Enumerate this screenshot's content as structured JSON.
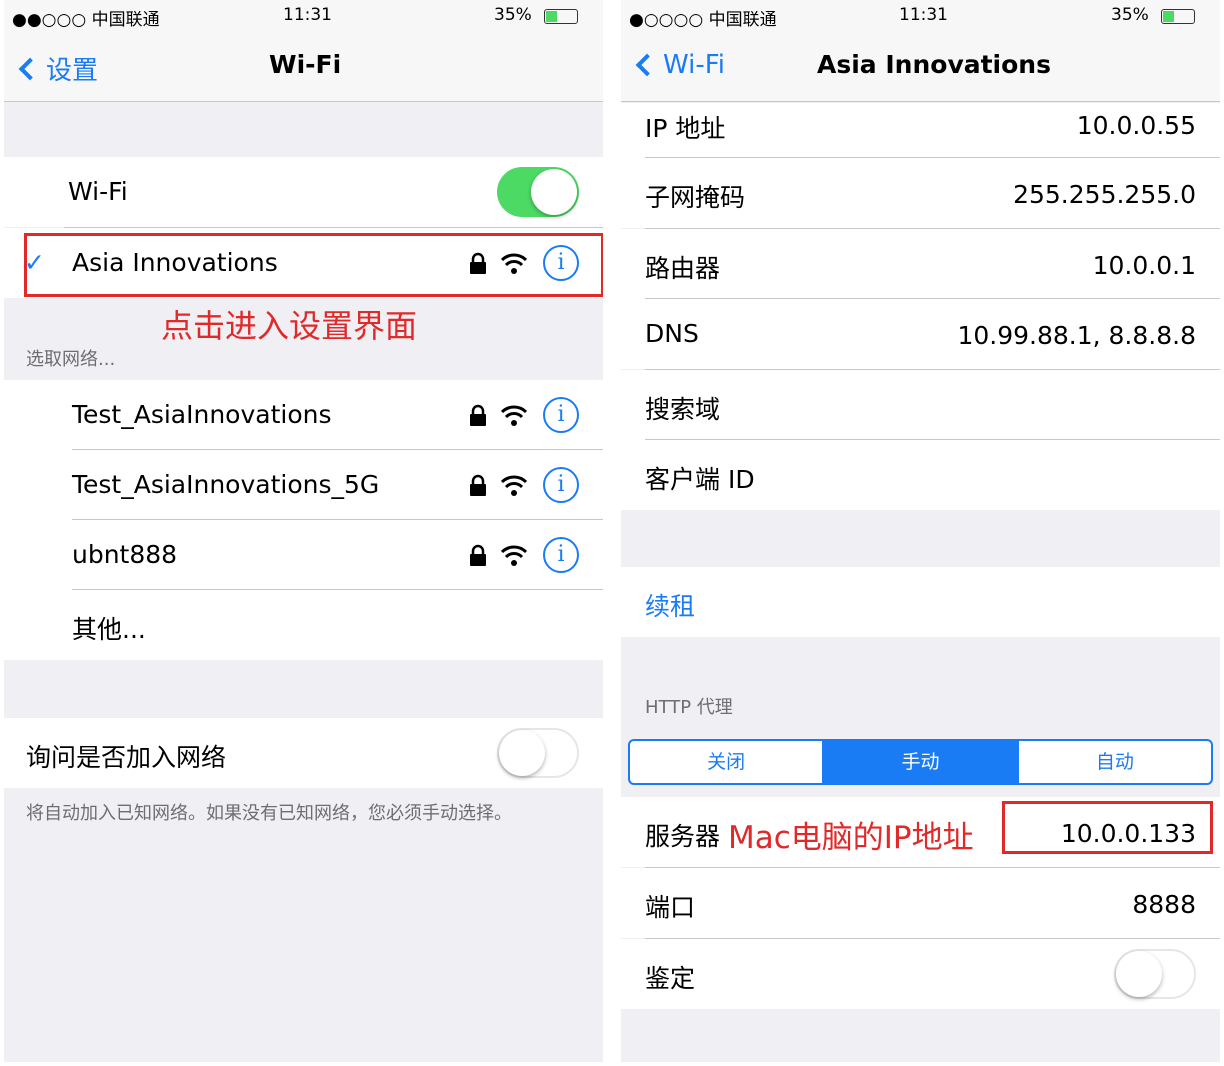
{
  "left": {
    "status": {
      "carrier": "●●○○○ 中国联通",
      "time": "11:31",
      "battery": "35%"
    },
    "nav": {
      "back": "设置",
      "title": "Wi-Fi"
    },
    "wifi_label": "Wi-Fi",
    "wifi_on": true,
    "connected": {
      "check": "✓",
      "name": "Asia Innovations"
    },
    "annotation": "点击进入设置界面",
    "choose_header": "选取网络...",
    "networks": [
      {
        "name": "Test_AsiaInnovations"
      },
      {
        "name": "Test_AsiaInnovations_5G"
      },
      {
        "name": "ubnt888"
      }
    ],
    "other": "其他...",
    "ask_label": "询问是否加入网络",
    "ask_on": false,
    "footer": "将自动加入已知网络。如果没有已知网络，您必须手动选择。"
  },
  "right": {
    "status": {
      "carrier": "●○○○○ 中国联通",
      "time": "11:31",
      "battery": "35%"
    },
    "nav": {
      "back": "Wi-Fi",
      "title": "Asia Innovations"
    },
    "details": [
      {
        "label": "IP 地址",
        "value": "10.0.0.55"
      },
      {
        "label": "子网掩码",
        "value": "255.255.255.0"
      },
      {
        "label": "路由器",
        "value": "10.0.0.1"
      },
      {
        "label": "DNS",
        "value": "10.99.88.1, 8.8.8.8"
      },
      {
        "label": "搜索域",
        "value": ""
      },
      {
        "label": "客户端 ID",
        "value": ""
      }
    ],
    "renew": "续租",
    "proxy_header": "HTTP 代理",
    "segments": [
      "关闭",
      "手动",
      "自动"
    ],
    "selected_segment": "手动",
    "server_label": "服务器",
    "server_annotation": "Mac电脑的IP地址",
    "server_value": "10.0.0.133",
    "port_label": "端口",
    "port_value": "8888",
    "auth_label": "鉴定",
    "auth_on": false
  },
  "colors": {
    "accent": "#1a7cf4",
    "toggle_on": "#4cd964",
    "annotation": "#e02a2a"
  }
}
